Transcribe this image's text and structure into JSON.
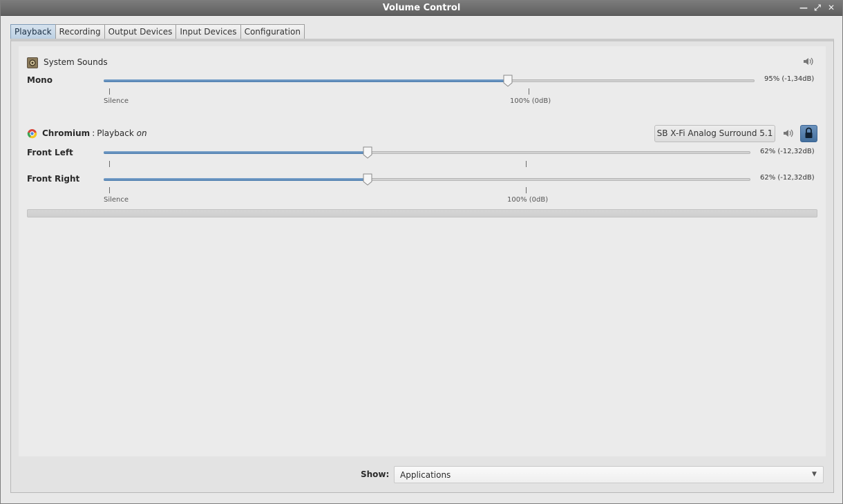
{
  "window": {
    "title": "Volume Control"
  },
  "tabs": [
    {
      "label": "Playback",
      "active": true
    },
    {
      "label": "Recording",
      "active": false
    },
    {
      "label": "Output Devices",
      "active": false
    },
    {
      "label": "Input Devices",
      "active": false
    },
    {
      "label": "Configuration",
      "active": false
    }
  ],
  "system_sounds": {
    "name": "System Sounds",
    "icon": "speaker-icon",
    "channel": {
      "label": "Mono",
      "value_text": "95% (-1,34dB)",
      "level": 0.95
    },
    "scale": {
      "min_label": "Silence",
      "mid_label": "100% (0dB)"
    }
  },
  "chromium": {
    "app_name": "Chromium",
    "separator": ":",
    "status_text": "Playback",
    "status_state": "on",
    "icon": "chromium-icon",
    "device": "SB X-Fi Analog Surround 5.1",
    "channels": [
      {
        "label": "Front Left",
        "value_text": "62% (-12,32dB)",
        "level": 0.62
      },
      {
        "label": "Front Right",
        "value_text": "62% (-12,32dB)",
        "level": 0.62
      }
    ],
    "scale": {
      "min_label": "Silence",
      "mid_label": "100% (0dB)"
    }
  },
  "footer": {
    "show_label": "Show:",
    "show_value": "Applications"
  },
  "colors": {
    "accent": "#4f7fae",
    "titlebar": "#6b6b6b",
    "lock": "#44709e"
  }
}
